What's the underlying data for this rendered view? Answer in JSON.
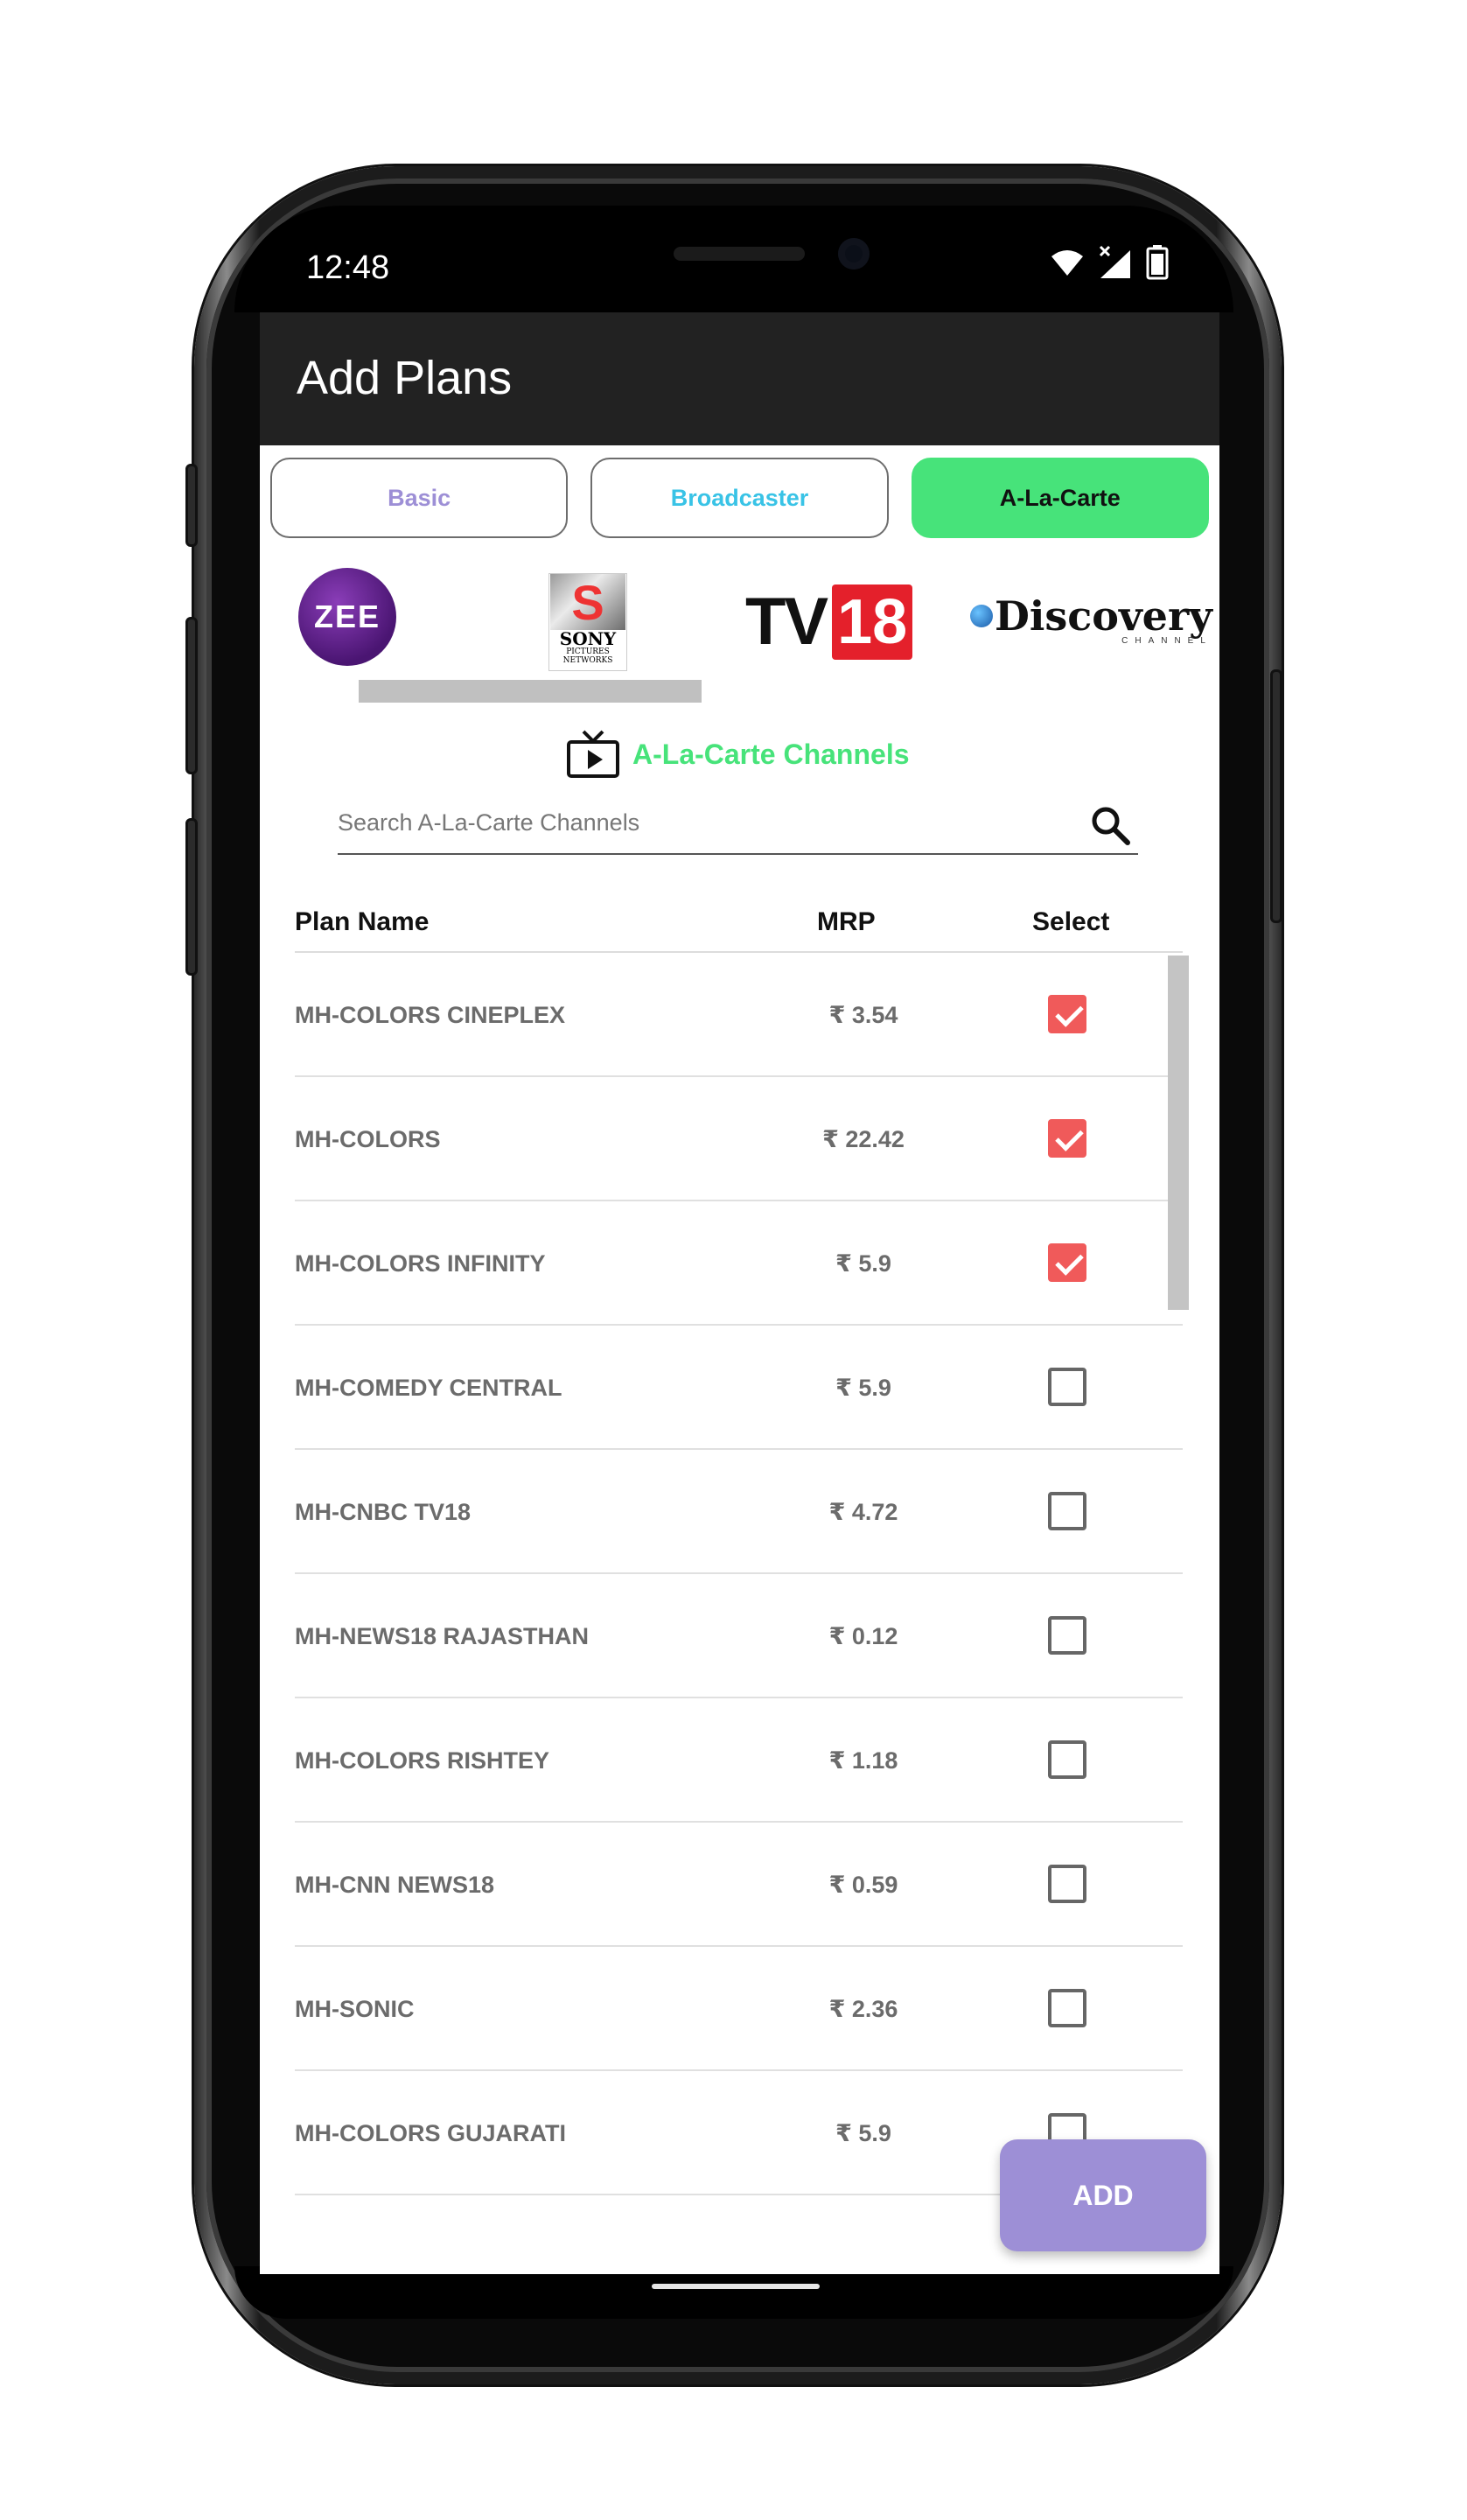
{
  "status_bar": {
    "time": "12:48"
  },
  "app_bar": {
    "title": "Add Plans"
  },
  "tabs": [
    {
      "label": "Basic",
      "color": "#9d8fd6",
      "active": false
    },
    {
      "label": "Broadcaster",
      "color": "#39c3e6",
      "active": false
    },
    {
      "label": "A-La-Carte",
      "color": "#47e37a",
      "active": true
    }
  ],
  "broadcasters": {
    "zee": "ZEE",
    "sony": {
      "word": "SONY",
      "sub": "PICTURES NETWORKS"
    },
    "tv18": {
      "text": "TV",
      "num": "18"
    },
    "discovery": {
      "word": "Discovery",
      "sub": "CHANNEL"
    }
  },
  "section": {
    "title": "A-La-Carte Channels",
    "icon": "tv-play-icon"
  },
  "search": {
    "placeholder": "Search A-La-Carte Channels",
    "value": ""
  },
  "table": {
    "headers": {
      "plan": "Plan Name",
      "mrp": "MRP",
      "select": "Select"
    },
    "rows": [
      {
        "plan": "MH-COLORS CINEPLEX",
        "mrp": "₹ 3.54",
        "selected": true
      },
      {
        "plan": "MH-COLORS",
        "mrp": "₹ 22.42",
        "selected": true
      },
      {
        "plan": "MH-COLORS INFINITY",
        "mrp": "₹ 5.9",
        "selected": true
      },
      {
        "plan": "MH-COMEDY CENTRAL",
        "mrp": "₹ 5.9",
        "selected": false
      },
      {
        "plan": "MH-CNBC TV18",
        "mrp": "₹ 4.72",
        "selected": false
      },
      {
        "plan": "MH-NEWS18 RAJASTHAN",
        "mrp": "₹ 0.12",
        "selected": false
      },
      {
        "plan": "MH-COLORS RISHTEY",
        "mrp": "₹ 1.18",
        "selected": false
      },
      {
        "plan": "MH-CNN NEWS18",
        "mrp": "₹ 0.59",
        "selected": false
      },
      {
        "plan": "MH-SONIC",
        "mrp": "₹ 2.36",
        "selected": false
      },
      {
        "plan": "MH-COLORS GUJARATI",
        "mrp": "₹ 5.9",
        "selected": false
      }
    ]
  },
  "actions": {
    "add_label": "ADD"
  },
  "colors": {
    "app_bar": "#222222",
    "accent_green": "#47e37a",
    "check_red": "#f05a5a",
    "add_purple": "#9d8fd6"
  }
}
